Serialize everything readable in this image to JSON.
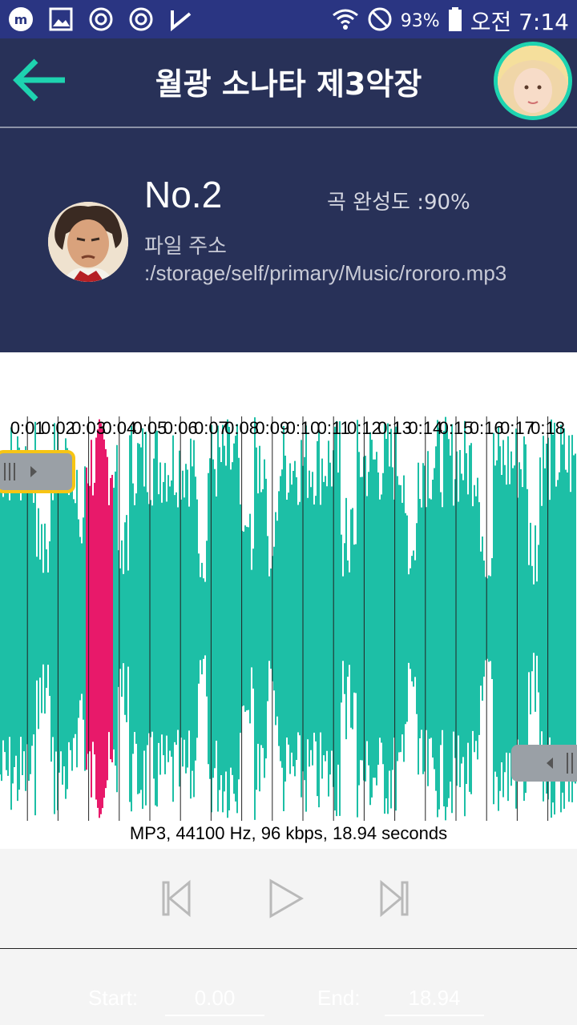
{
  "status_bar": {
    "battery": "93%",
    "time": "오전 7:14",
    "icons": [
      "m-app-icon",
      "image-icon",
      "sync-icon",
      "sync-icon",
      "check-flag-icon",
      "wifi-icon",
      "do-not-disturb-icon",
      "battery-icon"
    ]
  },
  "header": {
    "title": "월광 소나타 제3악장",
    "back_icon": "arrow-left-icon"
  },
  "track": {
    "number": "No.2",
    "completion": "곡 완성도 :90%",
    "file_path": "파일 주소 :/storage/self/primary/Music/rororo.mp3"
  },
  "waveform": {
    "tick_labels": [
      "0:01",
      "0:02",
      "0:03",
      "0:04",
      "0:05",
      "0:06",
      "0:07",
      "0:08",
      "0:09",
      "0:10",
      "0:11",
      "0:12",
      "0:13",
      "0:14",
      "0:15",
      "0:16",
      "0:17",
      "0:18"
    ],
    "total_seconds": 18.94,
    "playhead_seconds": [
      2.9,
      3.8
    ],
    "colors": {
      "wave": "#1dbfa6",
      "selection": "#e8196a",
      "handle_border": "#f7c514"
    }
  },
  "audio_info": "MP3, 44100 Hz, 96 kbps, 18.94 seconds",
  "controls": {
    "buttons": [
      "skip-previous-icon",
      "play-icon",
      "skip-next-icon"
    ]
  },
  "range": {
    "start_label": "Start:",
    "start_value": "0.00",
    "end_label": "End:",
    "end_value": "18.94"
  },
  "colors": {
    "status_bar": "#2a3582",
    "header": "#283158",
    "accent": "#1ed3b0"
  }
}
